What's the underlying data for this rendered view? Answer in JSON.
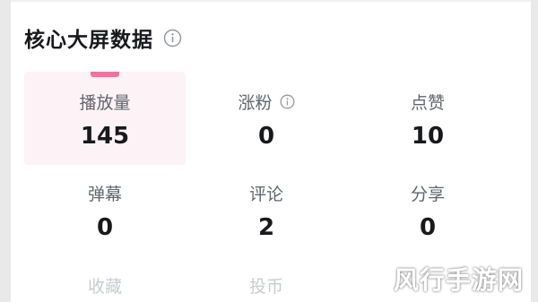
{
  "section": {
    "title": "核心大屏数据"
  },
  "metrics": [
    {
      "label": "播放量",
      "value": "145"
    },
    {
      "label": "涨粉",
      "value": "0"
    },
    {
      "label": "点赞",
      "value": "10"
    },
    {
      "label": "弹幕",
      "value": "0"
    },
    {
      "label": "评论",
      "value": "2"
    },
    {
      "label": "分享",
      "value": "0"
    },
    {
      "label": "收藏"
    },
    {
      "label": "投币"
    }
  ],
  "colors": {
    "accent": "#f0739d",
    "active_bg": "#fdf2f5",
    "title": "#18191c",
    "label": "#61666d"
  },
  "icons": {
    "title_info": "info-circle-icon",
    "fans_info": "info-circle-icon"
  },
  "watermark": "风行手游网"
}
